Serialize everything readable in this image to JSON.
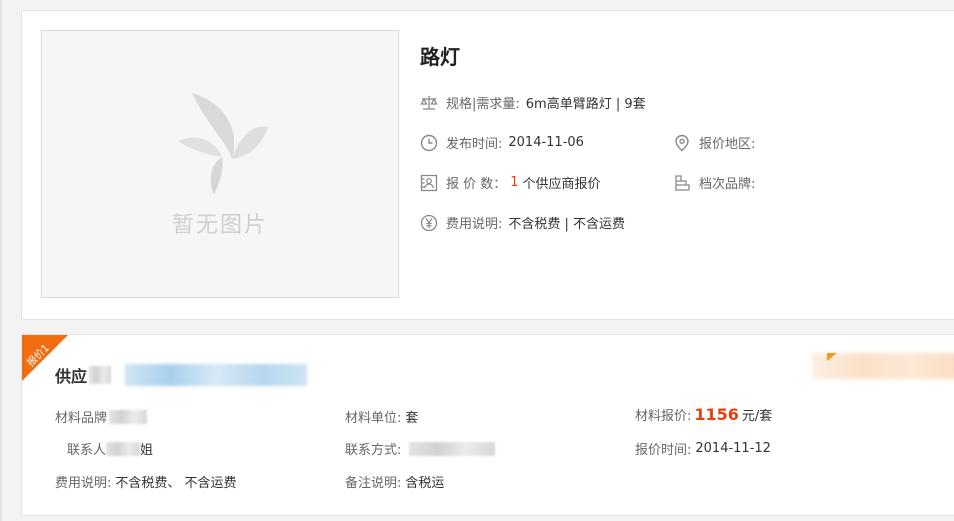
{
  "product": {
    "image_placeholder": "暂无图片",
    "title": "路灯",
    "spec_label": "规格|需求量:",
    "spec_value": "6m高单臂路灯 | 9套",
    "publish_label": "发布时间:",
    "publish_value": "2014-11-06",
    "region_label": "报价地区:",
    "region_value": "",
    "quote_count_label": "报 价 数：",
    "quote_count": "1",
    "quote_count_suffix": "个供应商报价",
    "brand_label": "档次品牌:",
    "brand_value": "",
    "fee_label": "费用说明:",
    "fee_value": "不含税费 | 不含运费"
  },
  "quote": {
    "badge": "报价1",
    "supplier_prefix": "供应",
    "material_brand_label": "材料品牌",
    "material_unit_label": "材料单位:",
    "material_unit_value": "套",
    "material_price_label": "材料报价:",
    "material_price_value": "1156",
    "material_price_unit": "元/套",
    "contact_label": "联系人",
    "contact_suffix": "姐",
    "contact_method_label": "联系方式:",
    "quote_time_label": "报价时间:",
    "quote_time_value": "2014-11-12",
    "fee_label": "费用说明:",
    "fee_value": "不含税费、 不含运费",
    "remark_label": "备注说明:",
    "remark_value": "含税运"
  },
  "icons": {
    "spec": "scale-icon",
    "time": "clock-icon",
    "region": "location-pin-icon",
    "count": "quote-count-icon",
    "brand": "brand-tier-icon",
    "fee": "yen-icon"
  },
  "colors": {
    "accent": "#e6400c",
    "badge": "#f06d10"
  }
}
